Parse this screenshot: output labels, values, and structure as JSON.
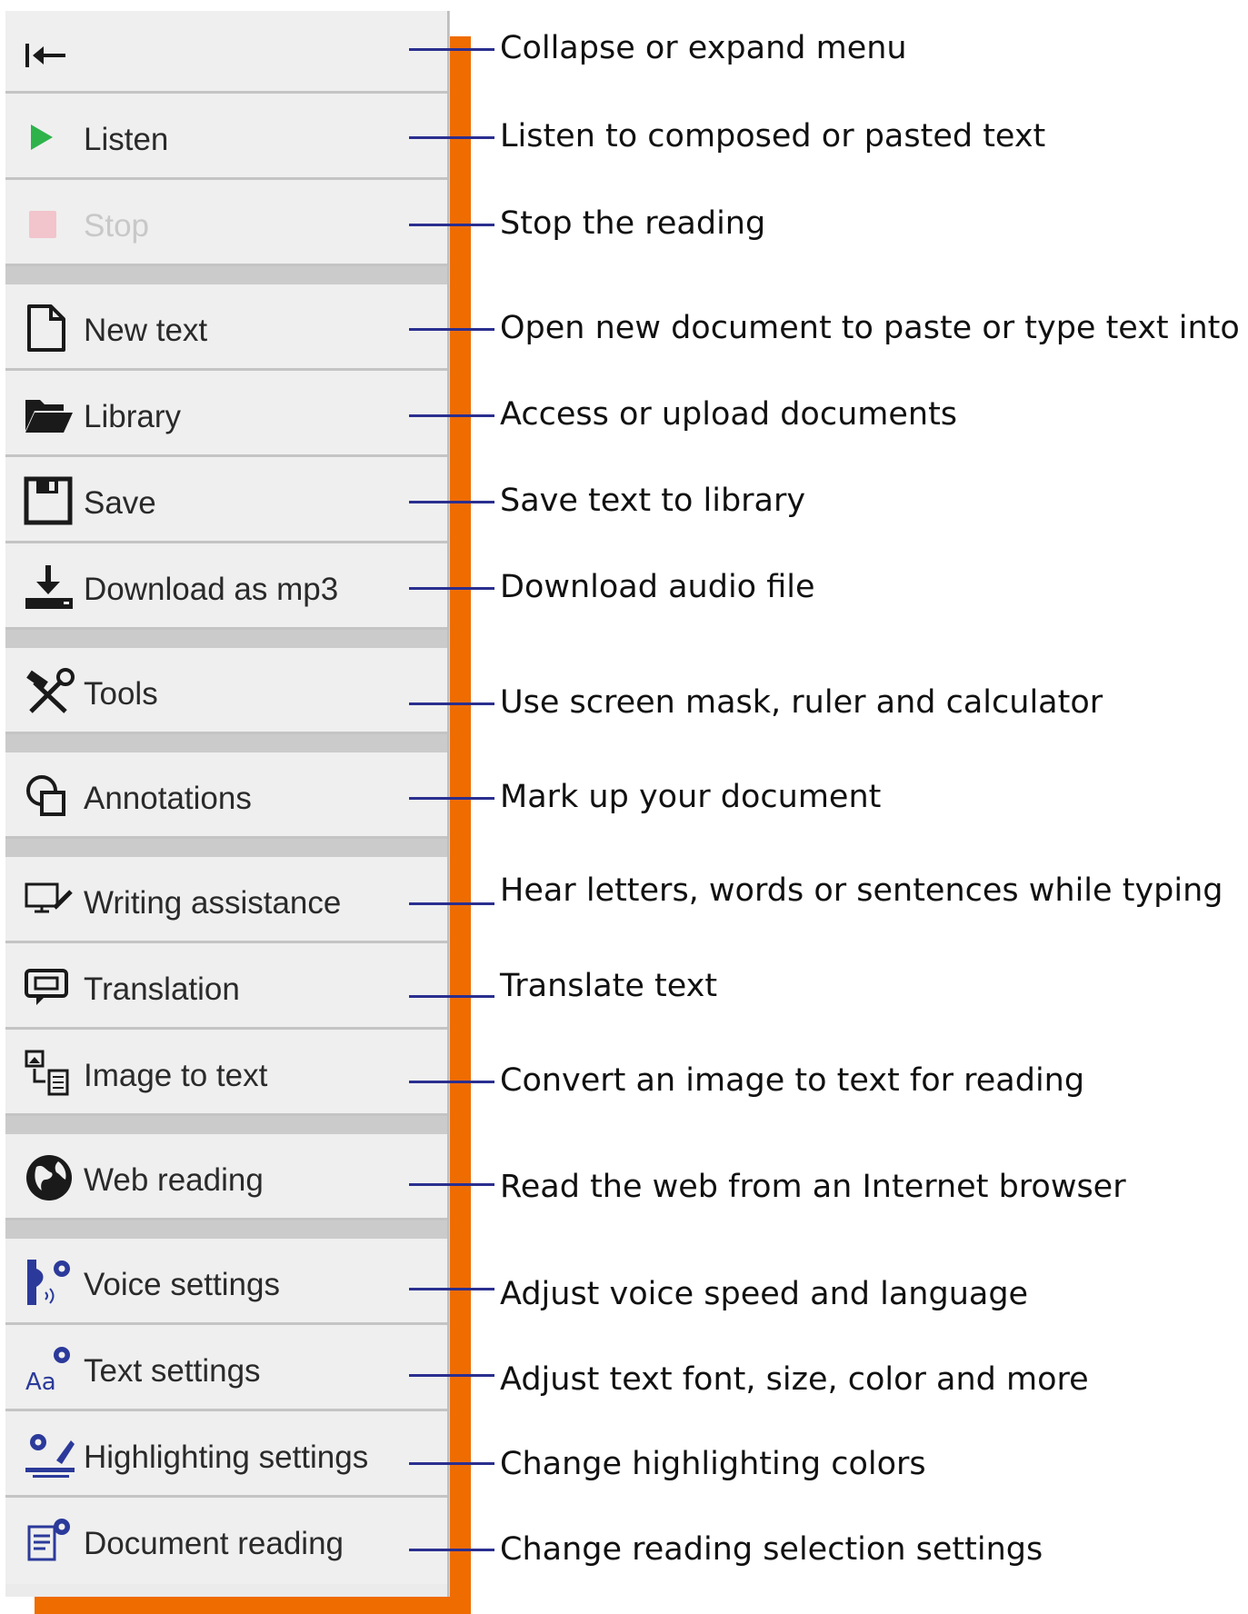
{
  "menu": {
    "collapse_label": "",
    "items": [
      {
        "key": "listen",
        "label": "Listen",
        "icon": "play-icon"
      },
      {
        "key": "stop",
        "label": "Stop",
        "icon": "stop-icon",
        "disabled": true
      },
      {
        "key": "new-text",
        "label": "New text",
        "icon": "document-icon"
      },
      {
        "key": "library",
        "label": "Library",
        "icon": "folder-open-icon"
      },
      {
        "key": "save",
        "label": "Save",
        "icon": "floppy-disk-icon"
      },
      {
        "key": "download",
        "label": "Download as mp3",
        "icon": "download-icon"
      },
      {
        "key": "tools",
        "label": "Tools",
        "icon": "hammer-wrench-icon"
      },
      {
        "key": "annotations",
        "label": "Annotations",
        "icon": "annotations-icon"
      },
      {
        "key": "writing",
        "label": "Writing assistance",
        "icon": "monitor-pen-icon"
      },
      {
        "key": "translation",
        "label": "Translation",
        "icon": "translation-icon"
      },
      {
        "key": "image-to-text",
        "label": "Image to text",
        "icon": "image-to-text-icon"
      },
      {
        "key": "web-reading",
        "label": "Web reading",
        "icon": "globe-icon"
      },
      {
        "key": "voice-settings",
        "label": "Voice settings",
        "icon": "voice-settings-icon"
      },
      {
        "key": "text-settings",
        "label": "Text settings",
        "icon": "text-settings-icon"
      },
      {
        "key": "highlighting-settings",
        "label": "Highlighting settings",
        "icon": "highlighting-settings-icon"
      },
      {
        "key": "document-reading",
        "label": "Document reading",
        "icon": "document-reading-icon"
      }
    ]
  },
  "annotations": [
    "Collapse or expand menu",
    "Listen to composed or pasted text",
    "Stop the reading",
    "Open new document to paste or type text into",
    "Access or upload documents",
    "Save text to library",
    "Download audio file",
    "Use screen mask, ruler and calculator",
    "Mark up your document",
    "Hear letters, words or sentences while typing",
    "Translate text",
    "Convert an image to text for reading",
    "Read the web from an Internet browser",
    "Adjust voice speed and language",
    "Adjust text font, size, color and more",
    "Change highlighting colors",
    "Change reading selection settings"
  ],
  "colors": {
    "accent_orange": "#ef6c00",
    "connector_navy": "#2a2f8f",
    "play_green": "#2db34a",
    "stop_pink": "#f2c4cc",
    "settings_blue": "#2b3a9a"
  }
}
